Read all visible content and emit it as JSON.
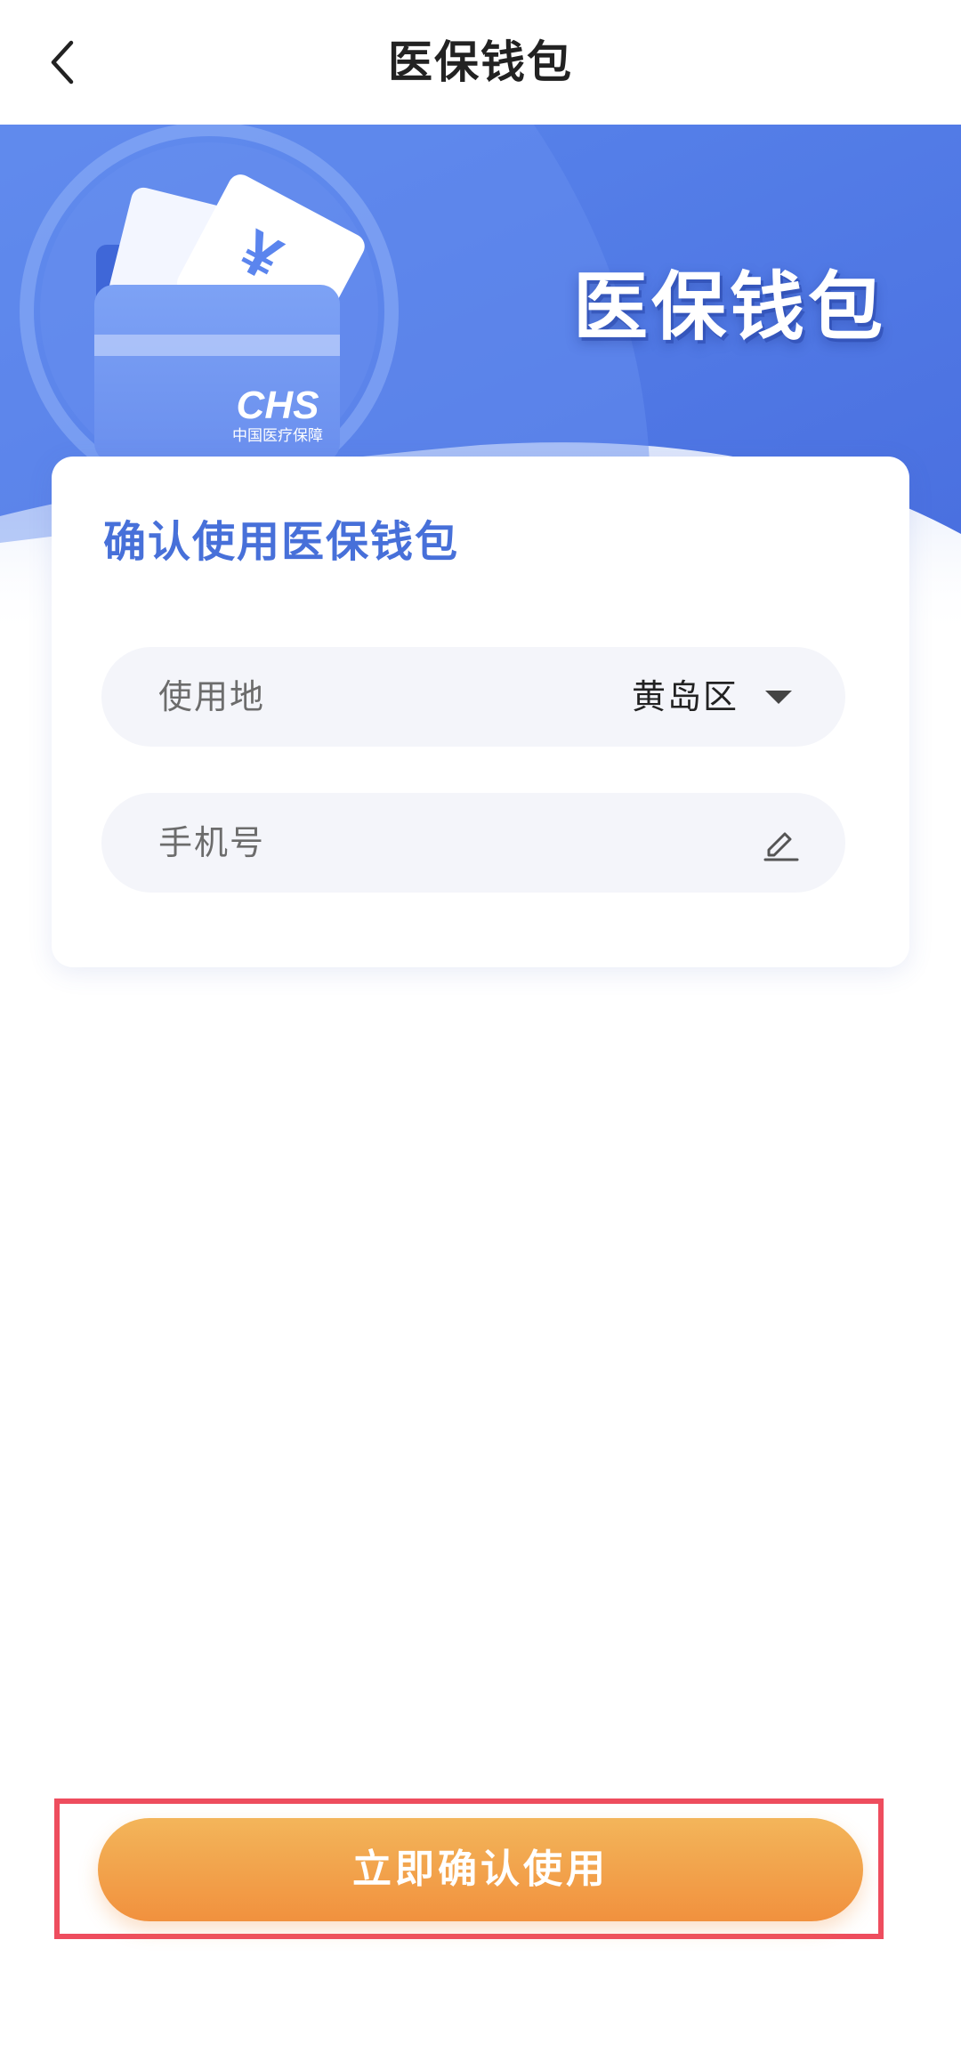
{
  "navbar": {
    "title": "医保钱包",
    "back_icon": "chevron-left-icon"
  },
  "banner": {
    "title": "医保钱包",
    "logo_text": "CHS",
    "logo_subtext": "中国医疗保障",
    "currency_symbol": "¥"
  },
  "card": {
    "title": "确认使用医保钱包",
    "location_label": "使用地",
    "location_value": "黄岛区",
    "phone_label": "手机号",
    "phone_value": ""
  },
  "confirm_button": {
    "label": "立即确认使用"
  },
  "colors": {
    "banner_blue": "#4a74e3",
    "accent_text": "#4770d9",
    "button_orange_top": "#f3b55a",
    "button_orange_bottom": "#f1913e",
    "highlight_red": "#ee4d5e"
  }
}
